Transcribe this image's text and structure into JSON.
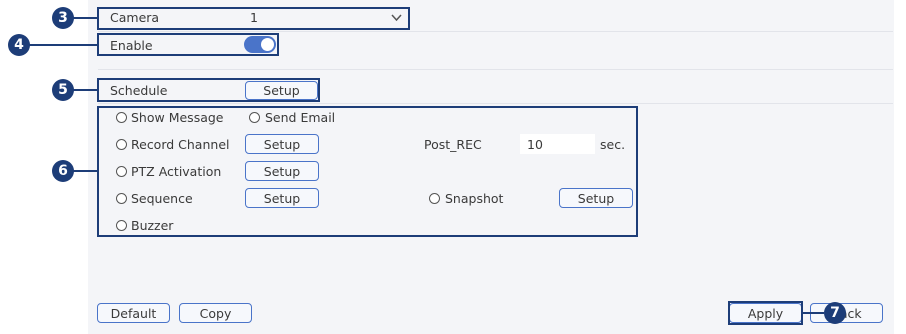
{
  "camera": {
    "label": "Camera",
    "value": "1"
  },
  "enable": {
    "label": "Enable",
    "on": true
  },
  "schedule": {
    "label": "Schedule",
    "setup": "Setup"
  },
  "actions": {
    "show_message": "Show Message",
    "send_email": "Send Email",
    "record_channel": "Record Channel",
    "record_setup": "Setup",
    "post_rec_label": "Post_REC",
    "post_rec_value": "10",
    "post_rec_unit": "sec.",
    "ptz_activation": "PTZ Activation",
    "ptz_setup": "Setup",
    "sequence": "Sequence",
    "sequence_setup": "Setup",
    "snapshot": "Snapshot",
    "snapshot_setup": "Setup",
    "buzzer": "Buzzer"
  },
  "footer": {
    "default": "Default",
    "copy": "Copy",
    "apply": "Apply",
    "back": "Back"
  },
  "callouts": {
    "c3": "3",
    "c4": "4",
    "c5": "5",
    "c6": "6",
    "c7": "7"
  },
  "colors": {
    "accent": "#4a74c9",
    "callout": "#1d3d78",
    "panel": "#f4f5f8"
  }
}
